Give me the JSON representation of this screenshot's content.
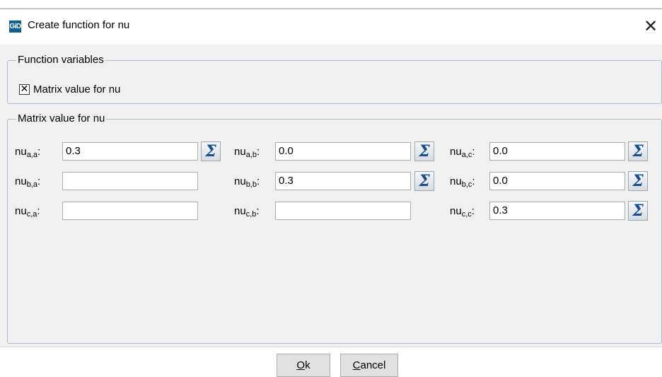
{
  "window": {
    "app_icon_text": "GiD",
    "title": "Create function for nu",
    "close_glyph": "✕"
  },
  "function_variables": {
    "legend": "Function variables",
    "checkbox_label": "Matrix value for nu",
    "checked": true
  },
  "matrix": {
    "legend": "Matrix value for nu",
    "base": "nu",
    "cells": [
      {
        "sub": "a,a",
        "value": "0.3",
        "has_sigma": true
      },
      {
        "sub": "a,b",
        "value": "0.0",
        "has_sigma": true
      },
      {
        "sub": "a,c",
        "value": "0.0",
        "has_sigma": true
      },
      {
        "sub": "b,a",
        "value": "",
        "has_sigma": false
      },
      {
        "sub": "b,b",
        "value": "0.3",
        "has_sigma": true
      },
      {
        "sub": "b,c",
        "value": "0.0",
        "has_sigma": true
      },
      {
        "sub": "c,a",
        "value": "",
        "has_sigma": false
      },
      {
        "sub": "c,b",
        "value": "",
        "has_sigma": false
      },
      {
        "sub": "c,c",
        "value": "0.3",
        "has_sigma": true
      }
    ]
  },
  "icons": {
    "sigma": "sigma-icon",
    "checkbox_mark": "✕"
  },
  "buttons": {
    "ok_mnemonic": "O",
    "ok_rest": "k",
    "cancel_mnemonic": "C",
    "cancel_rest": "ancel"
  }
}
